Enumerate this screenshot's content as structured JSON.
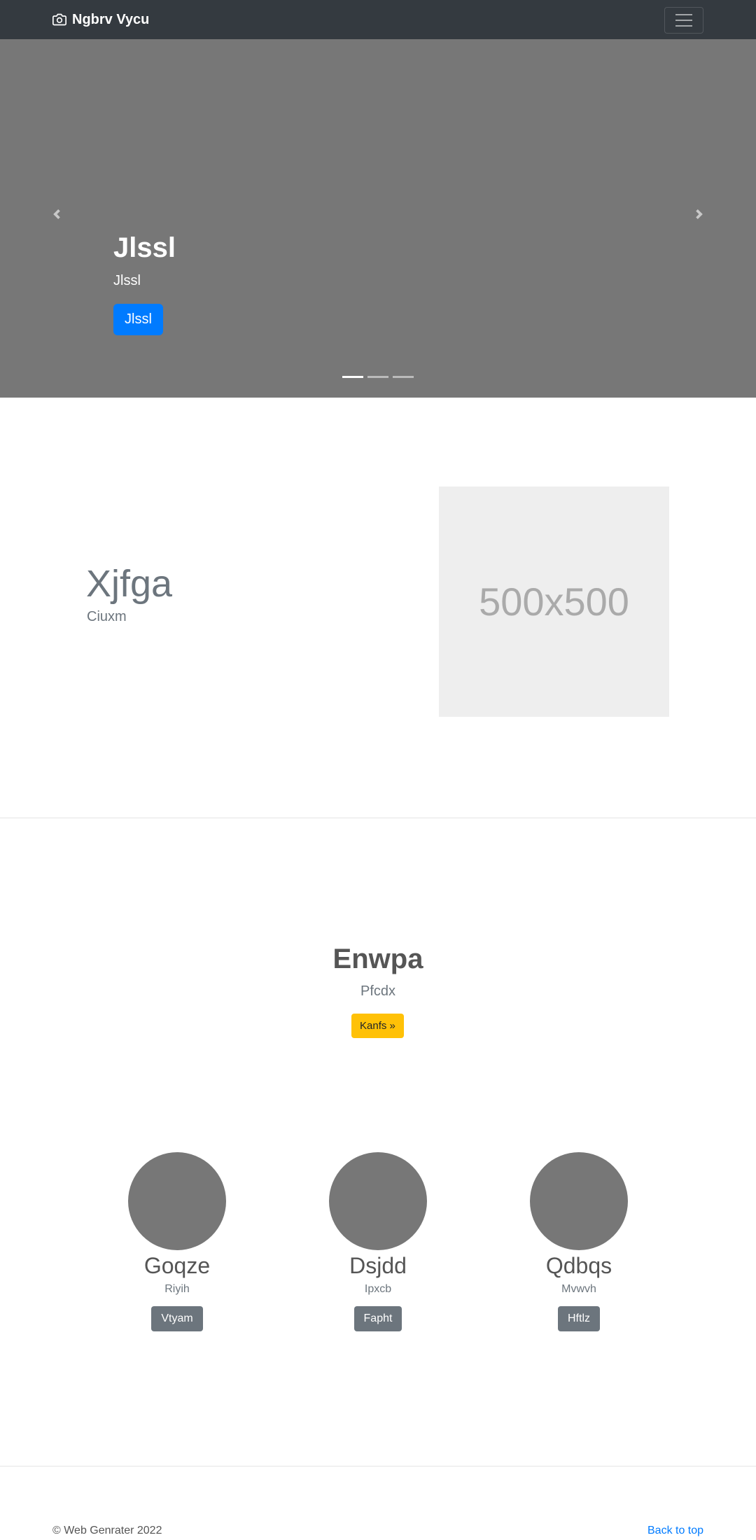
{
  "navbar": {
    "brand": "Ngbrv Vycu"
  },
  "carousel": {
    "title": "Jlssl",
    "subtitle": "Jlssl",
    "button": "Jlssl",
    "active_slide": 1,
    "slide_count": 3
  },
  "featurette": {
    "heading": "Xjfga",
    "subheading": "Ciuxm",
    "image_text": "500x500"
  },
  "jumbotron": {
    "heading": "Enwpa",
    "lead": "Pfcdx",
    "button": "Kanfs »"
  },
  "columns": [
    {
      "heading": "Goqze",
      "text": "Riyih",
      "button": "Vtyam"
    },
    {
      "heading": "Dsjdd",
      "text": "Ipxcb",
      "button": "Fapht"
    },
    {
      "heading": "Qdbqs",
      "text": "Mvwvh",
      "button": "Hftlz"
    }
  ],
  "footer": {
    "copyright": "© Web Genrater 2022",
    "back_to_top": "Back to top"
  },
  "colors": {
    "navbar": "#343a40",
    "primary": "#007bff",
    "warning": "#ffc107",
    "secondary": "#6c757d",
    "placeholder": "#777777"
  },
  "icons": {
    "brand": "camera-icon",
    "toggler": "hamburger-menu-icon",
    "prev": "chevron-left-icon",
    "next": "chevron-right-icon"
  }
}
